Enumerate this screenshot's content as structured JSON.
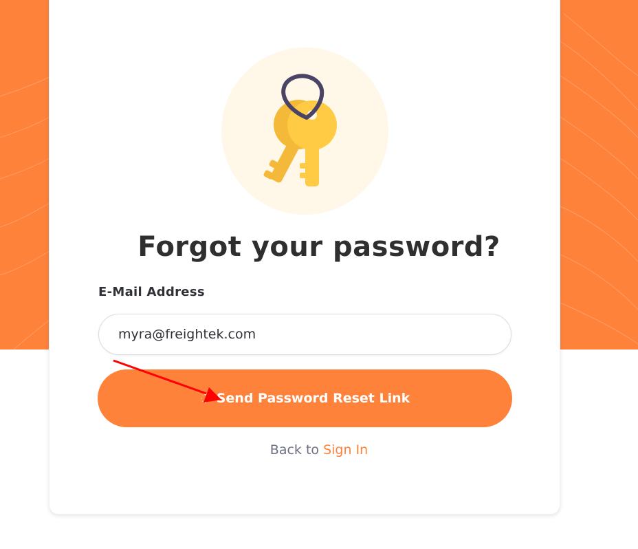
{
  "page": {
    "title": "Forgot your password?",
    "illustration_icon": "keys-icon"
  },
  "form": {
    "email_label": "E-Mail Address",
    "email_value": "myra@freightek.com",
    "submit_label": "Send Password Reset Link",
    "submit_icon": "spinner-icon"
  },
  "footer": {
    "back_text": "Back to",
    "sign_in_link": "Sign In"
  },
  "colors": {
    "accent": "#ff823b",
    "title": "#2f2f2f",
    "muted_text": "#6b6f80",
    "illustration_bg": "#fff8e8",
    "key_yellow": "#ffcb45",
    "key_ring": "#4a4366",
    "annotation_arrow": "#ff0000"
  },
  "annotation": {
    "type": "arrow",
    "target": "submit-button"
  }
}
